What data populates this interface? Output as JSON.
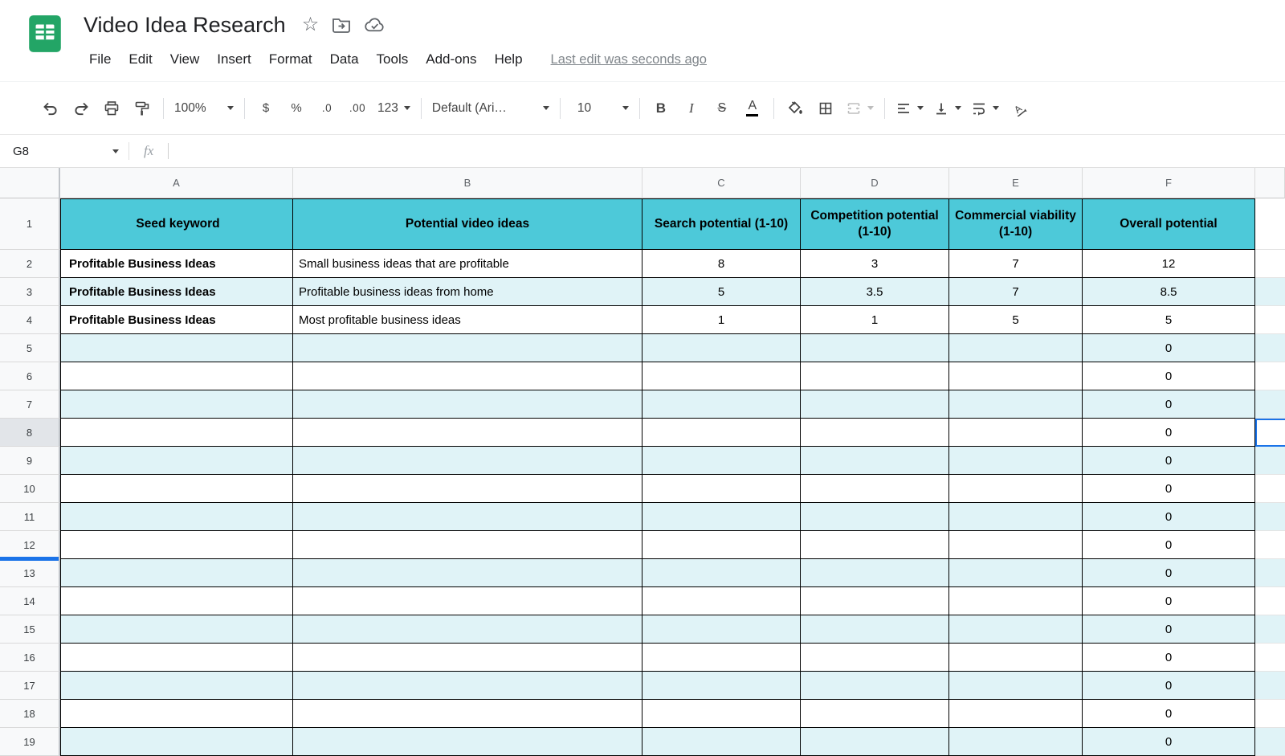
{
  "header": {
    "title": "Video Idea Research",
    "menu": [
      "File",
      "Edit",
      "View",
      "Insert",
      "Format",
      "Data",
      "Tools",
      "Add-ons",
      "Help"
    ],
    "last_edit": "Last edit was seconds ago"
  },
  "toolbar": {
    "zoom": "100%",
    "currency": "$",
    "percent": "%",
    "decrease_decimal": ".0",
    "increase_decimal": ".00",
    "more_formats": "123",
    "font": "Default (Ari…",
    "font_size": "10",
    "bold": "B",
    "italic": "I",
    "strikethrough": "S",
    "text_color": "A"
  },
  "formula_bar": {
    "cell_reference": "G8",
    "fx_label": "fx",
    "value": ""
  },
  "grid": {
    "column_letters": [
      "A",
      "B",
      "C",
      "D",
      "E",
      "F"
    ],
    "selected_cell": "G8",
    "selected_row": 8,
    "frozen_indicator_row": 12,
    "header_titles": [
      "Seed keyword",
      "Potential video ideas",
      "Search potential (1-10)",
      "Competition potential (1-10)",
      "Commercial viability (1-10)",
      "Overall potential"
    ],
    "data_rows": [
      {
        "row": 2,
        "cells": [
          "Profitable Business Ideas",
          "Small business ideas that are profitable",
          "8",
          "3",
          "7",
          "12"
        ]
      },
      {
        "row": 3,
        "cells": [
          "Profitable Business Ideas",
          "Profitable business ideas from home",
          "5",
          "3.5",
          "7",
          "8.5"
        ]
      },
      {
        "row": 4,
        "cells": [
          "Profitable Business Ideas",
          "Most profitable business ideas",
          "1",
          "1",
          "5",
          "5"
        ]
      },
      {
        "row": 5,
        "cells": [
          "",
          "",
          "",
          "",
          "",
          "0"
        ]
      },
      {
        "row": 6,
        "cells": [
          "",
          "",
          "",
          "",
          "",
          "0"
        ]
      },
      {
        "row": 7,
        "cells": [
          "",
          "",
          "",
          "",
          "",
          "0"
        ]
      },
      {
        "row": 8,
        "cells": [
          "",
          "",
          "",
          "",
          "",
          "0"
        ]
      },
      {
        "row": 9,
        "cells": [
          "",
          "",
          "",
          "",
          "",
          "0"
        ]
      },
      {
        "row": 10,
        "cells": [
          "",
          "",
          "",
          "",
          "",
          "0"
        ]
      },
      {
        "row": 11,
        "cells": [
          "",
          "",
          "",
          "",
          "",
          "0"
        ]
      },
      {
        "row": 12,
        "cells": [
          "",
          "",
          "",
          "",
          "",
          "0"
        ]
      },
      {
        "row": 13,
        "cells": [
          "",
          "",
          "",
          "",
          "",
          "0"
        ]
      },
      {
        "row": 14,
        "cells": [
          "",
          "",
          "",
          "",
          "",
          "0"
        ]
      },
      {
        "row": 15,
        "cells": [
          "",
          "",
          "",
          "",
          "",
          "0"
        ]
      },
      {
        "row": 16,
        "cells": [
          "",
          "",
          "",
          "",
          "",
          "0"
        ]
      },
      {
        "row": 17,
        "cells": [
          "",
          "",
          "",
          "",
          "",
          "0"
        ]
      },
      {
        "row": 18,
        "cells": [
          "",
          "",
          "",
          "",
          "",
          "0"
        ]
      },
      {
        "row": 19,
        "cells": [
          "",
          "",
          "",
          "",
          "",
          "0"
        ]
      }
    ]
  },
  "colors": {
    "header_fill": "#4dc9d9",
    "banding_fill": "#e0f3f7",
    "selection": "#1a73e8",
    "logo_green": "#23a566"
  }
}
